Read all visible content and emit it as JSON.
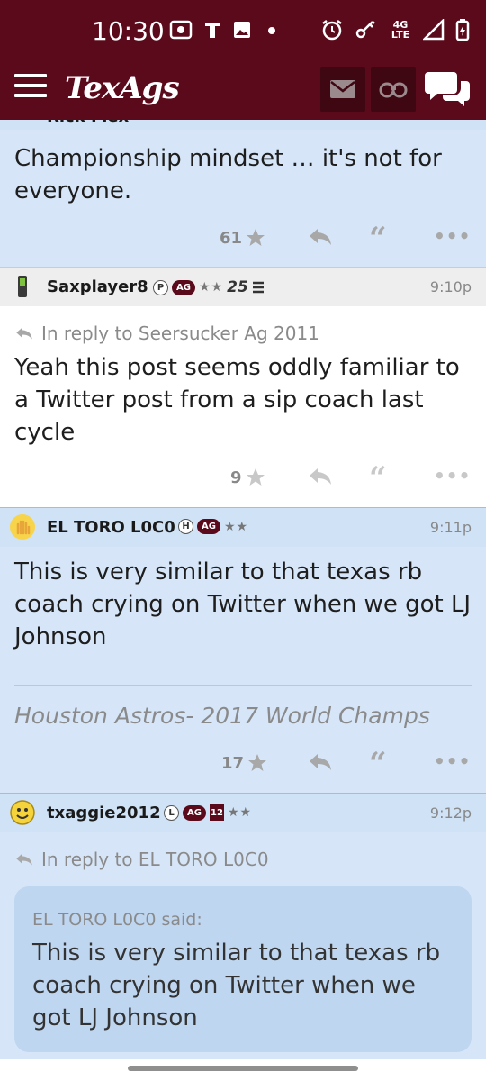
{
  "status_bar": {
    "time": "10:30",
    "network": "4G LTE"
  },
  "app": {
    "logo": "TexAgs"
  },
  "colors": {
    "maroon": "#5b0a1b",
    "post_blue": "#d6e6f8",
    "header_blue": "#cfe2f6",
    "header_gray": "#eeeeee",
    "quote_bg": "#bfd6f0"
  },
  "icons": [
    "menu-icon",
    "mail-icon",
    "binoculars-icon",
    "chat-icon",
    "star-icon",
    "reply-icon",
    "quote-icon",
    "more-icon"
  ],
  "posts": [
    {
      "author": "Rick Flex",
      "text": "Championship mindset … it's not for everyone.",
      "stars": "61"
    },
    {
      "author": "Saxplayer8",
      "badge_letter": "P",
      "badge_ag": "AG",
      "rating_stars": "★★",
      "badge_number": "25",
      "time": "9:10p",
      "reply_to": "In reply to Seersucker Ag 2011",
      "text": "Yeah this post seems oddly familiar to a Twitter post from a sip coach last cycle",
      "stars": "9"
    },
    {
      "author": "EL TORO L0C0",
      "badge_letter": "H",
      "badge_ag": "AG",
      "rating_stars": "★★",
      "time": "9:11p",
      "text": "This is very similar to that texas rb coach crying on Twitter when we got LJ Johnson",
      "signature": "Houston Astros- 2017 World Champs",
      "stars": "17"
    },
    {
      "author": "txaggie2012",
      "badge_letter": "L",
      "badge_ag": "AG",
      "badge_number": "12",
      "rating_stars": "★★",
      "time": "9:12p",
      "reply_to": "In reply to EL TORO L0C0",
      "quote_author": "EL TORO L0C0 said:",
      "quote_text": "This is very similar to that texas rb coach crying on Twitter when we got LJ Johnson"
    }
  ]
}
